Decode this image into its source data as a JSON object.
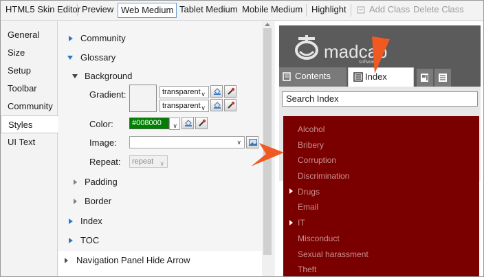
{
  "toolbar": {
    "title": "HTML5 Skin Editor",
    "buttons": [
      "Preview",
      "Web Medium",
      "Tablet Medium",
      "Mobile Medium",
      "Highlight",
      "Add Class",
      "Delete Class"
    ]
  },
  "left_nav": [
    "General",
    "Size",
    "Setup",
    "Toolbar",
    "Community",
    "Styles",
    "UI Text"
  ],
  "left_nav_selected": "Styles",
  "properties": {
    "community": "Community",
    "glossary": "Glossary",
    "background": "Background",
    "gradient_label": "Gradient:",
    "gradient_value_1": "transparent",
    "gradient_value_2": "transparent",
    "color_label": "Color:",
    "color_value": "#008000",
    "image_label": "Image:",
    "image_value": "",
    "repeat_label": "Repeat:",
    "repeat_value": "repeat",
    "padding": "Padding",
    "border": "Border",
    "index": "Index",
    "toc": "TOC",
    "nav_panel_hide_arrow": "Navigation Panel Hide Arrow"
  },
  "preview": {
    "logo_text": "madcap",
    "logo_sub": "software",
    "tabs": [
      "Contents",
      "Index"
    ],
    "active_tab": "Index",
    "search_placeholder": "Search Index",
    "index_items": [
      {
        "label": "Alcohol",
        "expandable": false
      },
      {
        "label": "Bribery",
        "expandable": false
      },
      {
        "label": "Corruption",
        "expandable": false
      },
      {
        "label": "Discrimination",
        "expandable": false
      },
      {
        "label": "Drugs",
        "expandable": true
      },
      {
        "label": "Email",
        "expandable": false
      },
      {
        "label": "IT",
        "expandable": true
      },
      {
        "label": "Misconduct",
        "expandable": false
      },
      {
        "label": "Sexual harassment",
        "expandable": false
      },
      {
        "label": "Theft",
        "expandable": false
      }
    ]
  },
  "colors": {
    "index_background": "#7a0000",
    "index_text": "#c89090",
    "callout_arrow": "#f05a22",
    "accent_blue": "#2b79c2",
    "color_swatch": "#008000"
  }
}
